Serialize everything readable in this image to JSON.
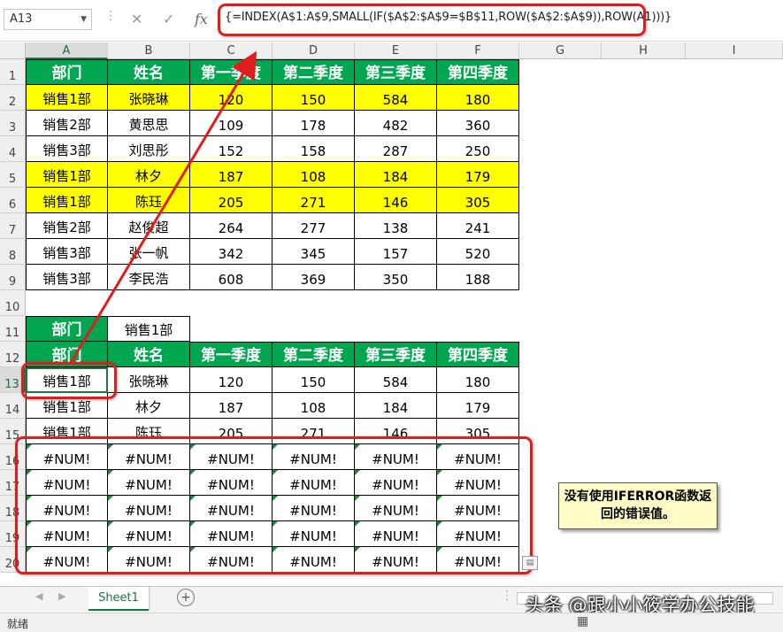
{
  "name_box": "A13",
  "formula": "{=INDEX(A$1:A$9,SMALL(IF($A$2:$A$9=$B$11,ROW($A$2:$A$9)),ROW(A1)))}",
  "formula_icons": {
    "cancel": "✕",
    "enter": "✓",
    "function": "fx"
  },
  "columns": [
    "A",
    "B",
    "C",
    "D",
    "E",
    "F",
    "G",
    "H",
    "I"
  ],
  "rows": [
    "1",
    "2",
    "3",
    "4",
    "5",
    "6",
    "7",
    "8",
    "9",
    "10",
    "11",
    "12",
    "13",
    "14",
    "15",
    "16",
    "17",
    "18",
    "19",
    "20"
  ],
  "table1": {
    "headers": [
      "部门",
      "姓名",
      "第一季度",
      "第二季度",
      "第三季度",
      "第四季度"
    ],
    "rows": [
      [
        "销售1部",
        "张晓琳",
        "120",
        "150",
        "584",
        "180"
      ],
      [
        "销售2部",
        "黄思思",
        "109",
        "178",
        "482",
        "360"
      ],
      [
        "销售3部",
        "刘思彤",
        "152",
        "158",
        "287",
        "250"
      ],
      [
        "销售1部",
        "林夕",
        "187",
        "108",
        "184",
        "179"
      ],
      [
        "销售1部",
        "陈珏",
        "205",
        "271",
        "146",
        "305"
      ],
      [
        "销售2部",
        "赵俊超",
        "264",
        "277",
        "138",
        "241"
      ],
      [
        "销售3部",
        "张一帆",
        "342",
        "345",
        "157",
        "520"
      ],
      [
        "销售3部",
        "李民浩",
        "608",
        "369",
        "350",
        "188"
      ]
    ],
    "highlight_color": "#ffff00"
  },
  "criteria": {
    "label": "部门",
    "value": "销售1部"
  },
  "table2": {
    "headers": [
      "部门",
      "姓名",
      "第一季度",
      "第二季度",
      "第三季度",
      "第四季度"
    ],
    "rows": [
      [
        "销售1部",
        "张晓琳",
        "120",
        "150",
        "584",
        "180"
      ],
      [
        "销售1部",
        "林夕",
        "187",
        "108",
        "184",
        "179"
      ],
      [
        "销售1部",
        "陈珏",
        "205",
        "271",
        "146",
        "305"
      ]
    ],
    "error_value": "#NUM!",
    "error_rows": 5
  },
  "callout_text": "没有使用IFERROR函数返回的错误值。",
  "sheet_tab": "Sheet1",
  "status": "就绪",
  "watermark": "头条 @跟小小筱学办公技能",
  "colors": {
    "header_green": "#00a650",
    "accent_red": "#e01d1d",
    "excel_green": "#217346",
    "callout_bg": "#fffcc8"
  }
}
